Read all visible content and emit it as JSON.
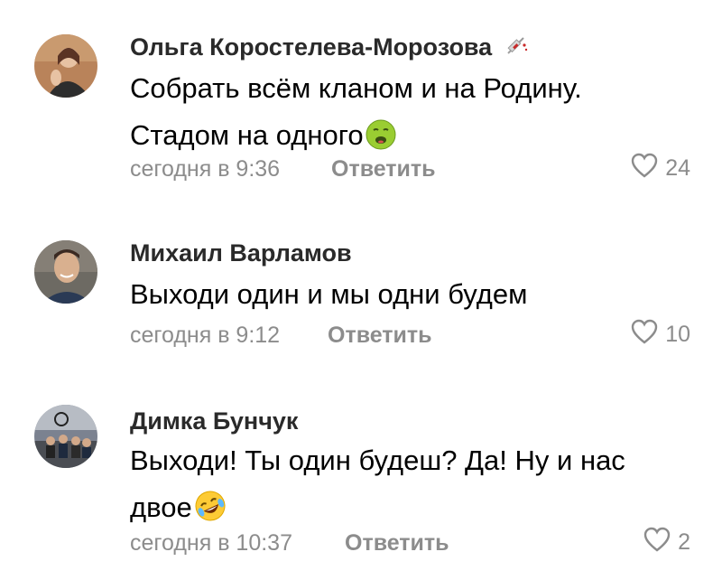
{
  "comments": [
    {
      "author": "Ольга Коростелева-Морозова",
      "badge_icon": "syringe-icon",
      "lines": [
        "Собрать всём кланом и на Родину.",
        "Стадом на одного"
      ],
      "emoji_icon": "nauseated-face-icon",
      "time": "сегодня в 9:36",
      "reply_label": "Ответить",
      "likes": "24"
    },
    {
      "author": "Михаил Варламов",
      "lines": [
        "Выходи один и мы одни будем"
      ],
      "time": "сегодня в 9:12",
      "reply_label": "Ответить",
      "likes": "10"
    },
    {
      "author": "Димка Бунчук",
      "lines": [
        "Выходи! Ты один будеш?  Да! Ну и нас",
        "двое"
      ],
      "emoji_icon": "rofl-face-icon",
      "time": "сегодня в 10:37",
      "reply_label": "Ответить",
      "likes": "2"
    }
  ],
  "colors": {
    "meta_gray": "#8c8c8c",
    "author_text": "#2a2a2a"
  }
}
